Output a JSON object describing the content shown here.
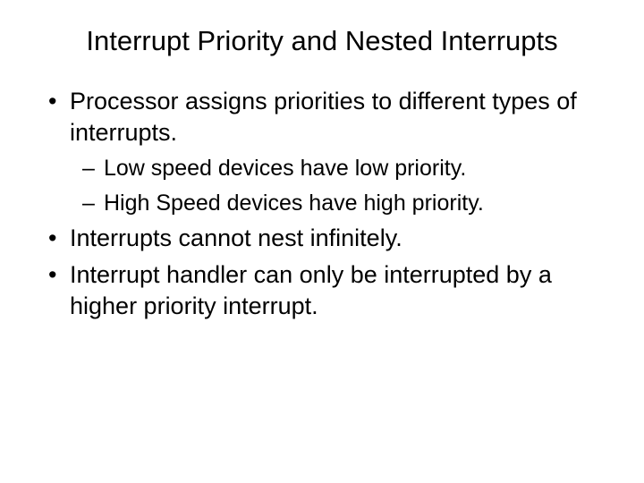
{
  "slide": {
    "title": "Interrupt Priority and Nested Interrupts",
    "bullets": [
      {
        "text": "Processor assigns priorities to different types of interrupts.",
        "subs": [
          {
            "text": "Low speed devices have low priority."
          },
          {
            "text": "High Speed devices have high priority."
          }
        ]
      },
      {
        "text": "Interrupts cannot nest infinitely.",
        "subs": []
      },
      {
        "text": "Interrupt handler can only be interrupted by a higher priority interrupt.",
        "subs": []
      }
    ]
  }
}
